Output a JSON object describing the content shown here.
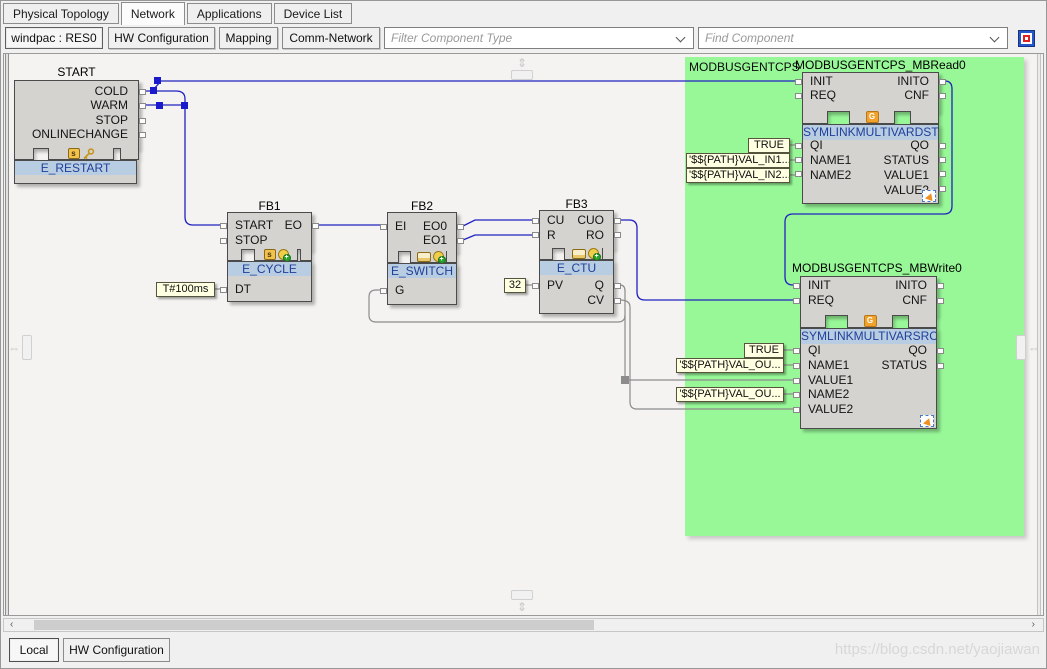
{
  "header": {
    "tabs": [
      "Physical Topology",
      "Network",
      "Applications",
      "Device List"
    ],
    "active_tab": "Network"
  },
  "toolbar": {
    "buttons": [
      "windpac : RES0",
      "HW Configuration",
      "Mapping",
      "Comm-Network"
    ],
    "filter_placeholder": "Filter Component Type",
    "find_placeholder": "Find Component",
    "icons": [
      "combo-dropdown-icon",
      "highlight-target-icon"
    ]
  },
  "canvas": {
    "group_label": "MODBUSGENTCPS",
    "colors": {
      "group_bg": "#98f898",
      "event_wire": "#2020c0",
      "data_wire": "#8c8c8c",
      "block_bg": "#d5d3d0",
      "type_band_bg": "#b9cde2",
      "type_band_text": "#20409a",
      "value_box_bg": "#ffffe1"
    },
    "blocks": {
      "start": {
        "name": "START",
        "type": "E_RESTART",
        "event_outputs": [
          "COLD",
          "WARM",
          "STOP",
          "ONLINECHANGE"
        ],
        "icons": [
          "s-badge-icon",
          "key-icon"
        ]
      },
      "fb1": {
        "name": "FB1",
        "type": "E_CYCLE",
        "event_inputs": [
          "START",
          "STOP"
        ],
        "event_outputs": [
          "EO"
        ],
        "data_inputs": [
          "DT"
        ],
        "values": {
          "DT": "T#100ms"
        },
        "icons": [
          "s-badge-icon",
          "gear-plus-icon"
        ]
      },
      "fb2": {
        "name": "FB2",
        "type": "E_SWITCH",
        "event_inputs": [
          "EI"
        ],
        "event_outputs": [
          "EO0",
          "EO1"
        ],
        "data_inputs": [
          "G"
        ],
        "icons": [
          "chip-icon",
          "gear-plus-icon"
        ]
      },
      "fb3": {
        "name": "FB3",
        "type": "E_CTU",
        "event_inputs": [
          "CU",
          "R"
        ],
        "event_outputs": [
          "CUO",
          "RO"
        ],
        "data_inputs": [
          "PV"
        ],
        "data_outputs": [
          "Q",
          "CV"
        ],
        "values": {
          "PV": "32"
        },
        "icons": [
          "chip-icon",
          "gear-plus-icon"
        ]
      },
      "mbread": {
        "name": "MODBUSGENTCPS_MBRead0",
        "type": "SYMLINKMULTIVARDST",
        "event_inputs": [
          "INIT",
          "REQ"
        ],
        "event_outputs": [
          "INITO",
          "CNF"
        ],
        "data_inputs": [
          "QI",
          "NAME1",
          "NAME2"
        ],
        "data_outputs": [
          "QO",
          "STATUS",
          "VALUE1",
          "VALUE2"
        ],
        "values": {
          "QI": "TRUE",
          "NAME1": "'$${PATH}VAL_IN1...",
          "NAME2": "'$${PATH}VAL_IN2..."
        },
        "icons": [
          "g-badge-icon",
          "mapped-icon"
        ]
      },
      "mbwrite": {
        "name": "MODBUSGENTCPS_MBWrite0",
        "type": "SYMLINKMULTIVARSRC",
        "event_inputs": [
          "INIT",
          "REQ"
        ],
        "event_outputs": [
          "INITO",
          "CNF"
        ],
        "data_inputs": [
          "QI",
          "NAME1",
          "VALUE1",
          "NAME2",
          "VALUE2"
        ],
        "data_outputs": [
          "QO",
          "STATUS"
        ],
        "values": {
          "QI": "TRUE",
          "NAME1": "'$${PATH}VAL_OU...",
          "NAME2": "'$${PATH}VAL_OU..."
        },
        "icons": [
          "g-badge-icon",
          "mapped-icon"
        ]
      }
    }
  },
  "statusbar": {
    "tabs": [
      "Local",
      "HW Configuration"
    ],
    "active_tab": "Local"
  },
  "watermark": "https://blog.csdn.net/yaojiawan"
}
